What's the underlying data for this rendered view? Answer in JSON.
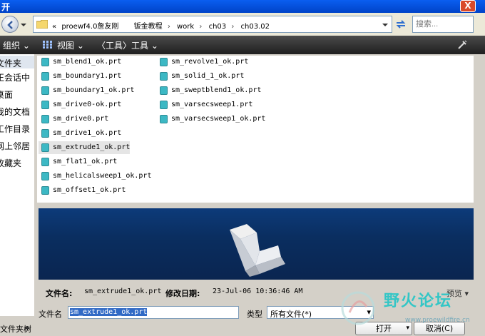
{
  "window": {
    "title": "开",
    "close_glyph": "X"
  },
  "address": {
    "overflow_glyph": "«",
    "crumbs": [
      "proewf4.0詹友刚",
      "钣金教程",
      "work",
      "ch03",
      "ch03.02"
    ],
    "separator": "›"
  },
  "search": {
    "placeholder": "搜索..."
  },
  "toolbar": {
    "organize": "组织",
    "views": "视图",
    "tools": "〈工具〉工具"
  },
  "sidebar": {
    "items": [
      "文件夹",
      "正会话中",
      "桌面",
      "我的文档",
      "工作目录",
      "网上邻居",
      "收藏夹"
    ]
  },
  "files": {
    "column1": [
      "sm_blend1_ok.prt",
      "sm_boundary1.prt",
      "sm_boundary1_ok.prt",
      "sm_drive0-ok.prt",
      "sm_drive0.prt",
      "sm_drive1_ok.prt",
      "sm_extrude1_ok.prt",
      "sm_flat1_ok.prt",
      "sm_helicalsweep1_ok.prt",
      "sm_offset1_ok.prt"
    ],
    "column2": [
      "sm_revolve1_ok.prt",
      "sm_solid_1_ok.prt",
      "sm_sweptblend1_ok.prt",
      "sm_varsecsweep1.prt",
      "sm_varsecsweep1_ok.prt"
    ],
    "selected": "sm_extrude1_ok.prt"
  },
  "details": {
    "filename_label": "文件名:",
    "filename_value": "sm_extrude1_ok.prt",
    "modified_label": "修改日期:",
    "modified_value": "23-Jul-06 10:36:46 AM",
    "preview_label": "预览"
  },
  "form": {
    "filename_label": "文件名",
    "filename_value": "sm_extrude1_ok.prt",
    "type_label": "类型",
    "type_value": "所有文件(*)"
  },
  "buttons": {
    "collapse": "文件夹树",
    "open": "打开",
    "cancel": "取消(C)"
  },
  "watermark": {
    "text": "野火论坛",
    "url": "www.proewildfire.cn"
  },
  "colors": {
    "title_bar": "#0a5ef0",
    "toolbar": "#2b2b2b",
    "preview_bg": "#0a2e60",
    "file_icon": "#3cb8c4",
    "selection": "#316ac5"
  }
}
